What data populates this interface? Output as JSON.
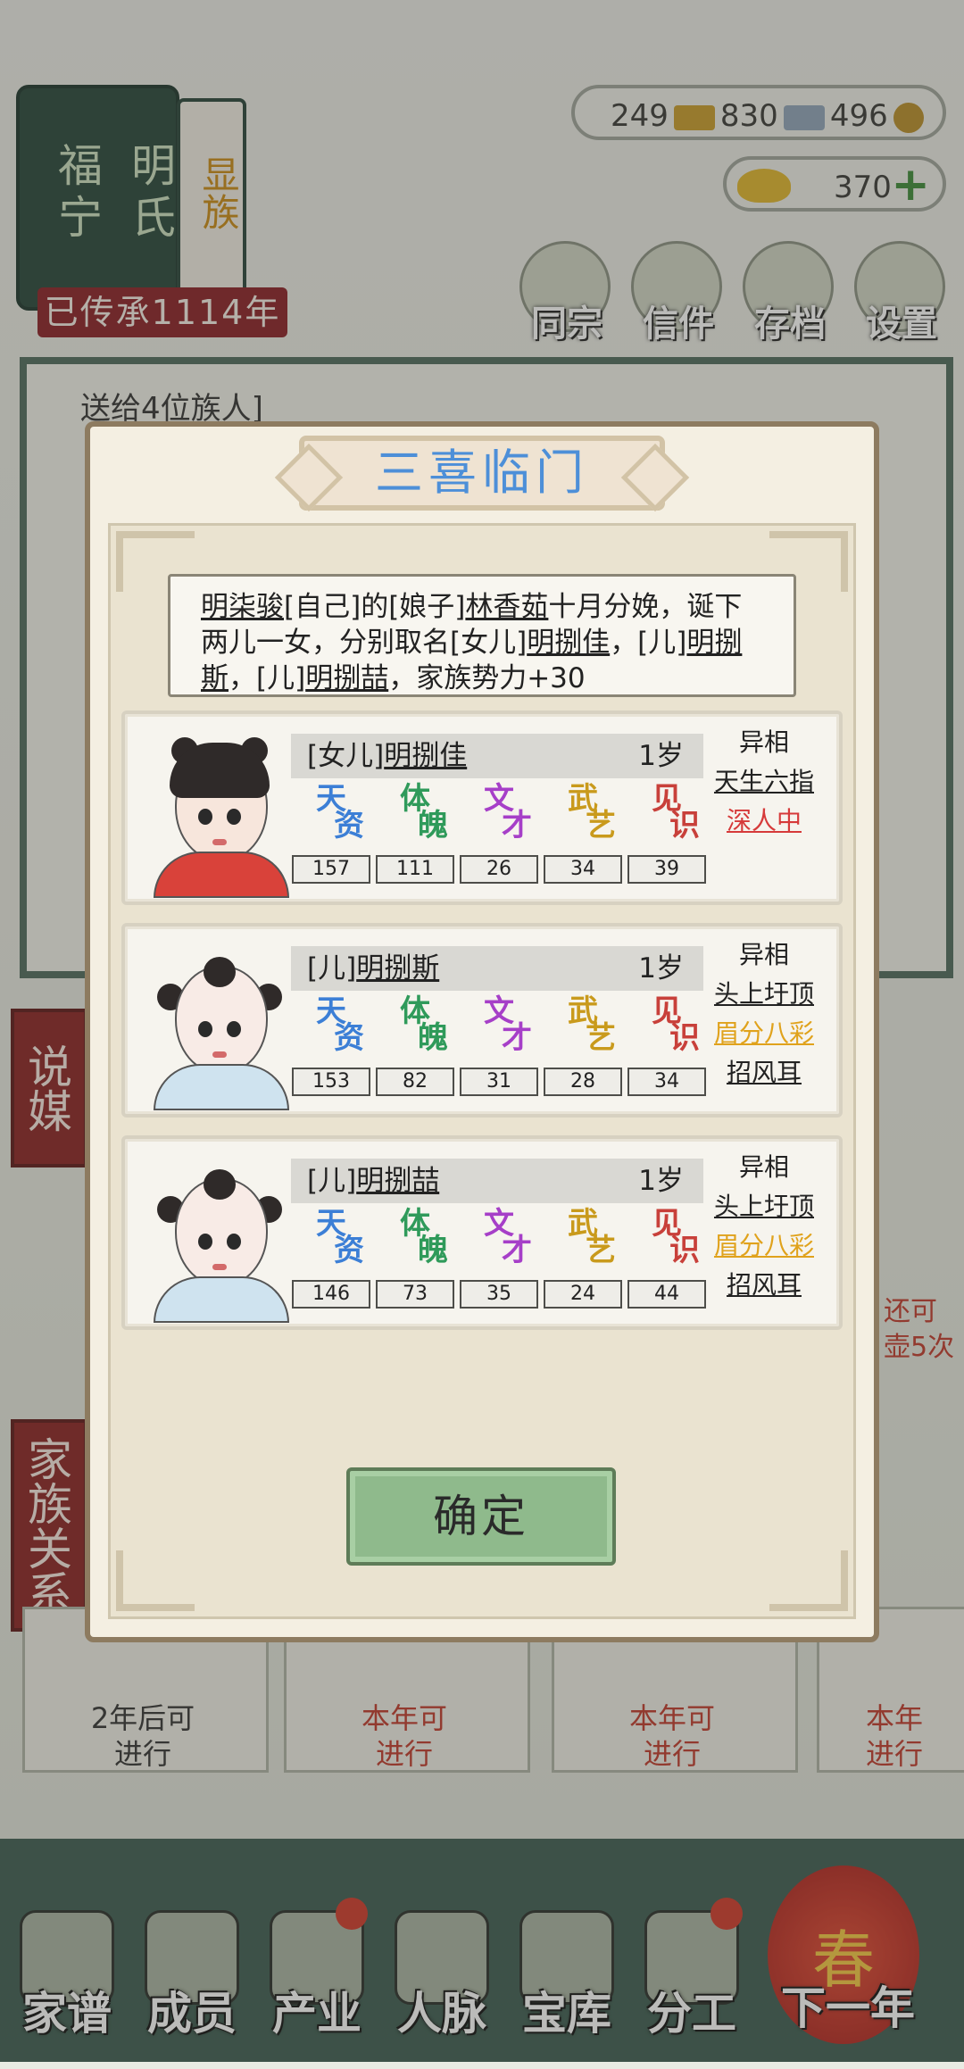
{
  "header": {
    "clan_banner": [
      "福宁",
      "明氏"
    ],
    "clan_tag": "显族",
    "legacy": "已传承1114年",
    "resources": {
      "gold_bars": "249",
      "silver_bars": "830",
      "coins": "496"
    },
    "ingot": "370",
    "menu": [
      {
        "label": "同宗",
        "icon": "books-icon"
      },
      {
        "label": "信件",
        "icon": "letter-icon"
      },
      {
        "label": "存档",
        "icon": "scroll-icon"
      },
      {
        "label": "设置",
        "icon": "gear-icon"
      }
    ]
  },
  "background": {
    "gift_text": "送给4位族人]",
    "side_buttons": [
      "说媒",
      "家族关系"
    ],
    "cards": [
      {
        "text_line1": "2年后可",
        "text_line2": "进行",
        "color": "#333333"
      },
      {
        "text_line1": "本年可",
        "text_line2": "进行",
        "color": "#c0392b"
      },
      {
        "text_line1": "本年可",
        "text_line2": "进行",
        "color": "#c0392b"
      },
      {
        "text_line1": "本年",
        "text_line2": "进行",
        "color": "#c0392b"
      }
    ],
    "right_note": [
      "还可",
      "壶5次"
    ]
  },
  "bottom_nav": [
    {
      "label": "家谱",
      "icon": "genealogy-book-icon"
    },
    {
      "label": "成员",
      "icon": "member-icon"
    },
    {
      "label": "产业",
      "icon": "building-icon"
    },
    {
      "label": "人脉",
      "icon": "network-icon"
    },
    {
      "label": "宝库",
      "icon": "treasure-box-icon"
    },
    {
      "label": "分工",
      "icon": "scroll-task-icon"
    },
    {
      "label": "下一年",
      "icon": "lantern-icon"
    }
  ],
  "lantern_char": "春",
  "modal": {
    "title": "三喜临门",
    "message": {
      "p1": "明柒骏",
      "p2": "[自己]的[娘子]",
      "p3": "林香茹",
      "p4": "十月分娩，诞下两儿一女，分别取名[女儿]",
      "p5": "明捌佳",
      "p6": "，[儿]",
      "p7": "明捌斯",
      "p8": "，[儿]",
      "p9": "明捌喆",
      "p10": "，家族势力+30"
    },
    "stat_labels": [
      {
        "a": "天",
        "b": "资",
        "color": "#3c7fd6"
      },
      {
        "a": "体",
        "b": "魄",
        "color": "#2f9a5a"
      },
      {
        "a": "文",
        "b": "才",
        "color": "#a63fc8"
      },
      {
        "a": "武",
        "b": "艺",
        "color": "#c99a1c"
      },
      {
        "a": "见",
        "b": "识",
        "color": "#c8403a"
      }
    ],
    "children": [
      {
        "relation": "[女儿]",
        "name": "明捌佳",
        "age": "1岁",
        "stats": [
          "157",
          "111",
          "26",
          "34",
          "39"
        ],
        "traits_title": "异相",
        "traits": [
          {
            "text": "天生六指",
            "color": "#222222"
          },
          {
            "text": "深人中",
            "color": "#d63a3a"
          }
        ]
      },
      {
        "relation": "[儿]",
        "name": "明捌斯",
        "age": "1岁",
        "stats": [
          "153",
          "82",
          "31",
          "28",
          "34"
        ],
        "traits_title": "异相",
        "traits": [
          {
            "text": "头上圩顶",
            "color": "#222222"
          },
          {
            "text": "眉分八彩",
            "color": "#e0a21c"
          },
          {
            "text": "招风耳",
            "color": "#222222"
          }
        ]
      },
      {
        "relation": "[儿]",
        "name": "明捌喆",
        "age": "1岁",
        "stats": [
          "146",
          "73",
          "35",
          "24",
          "44"
        ],
        "traits_title": "异相",
        "traits": [
          {
            "text": "头上圩顶",
            "color": "#222222"
          },
          {
            "text": "眉分八彩",
            "color": "#e0a21c"
          },
          {
            "text": "招风耳",
            "color": "#222222"
          }
        ]
      }
    ],
    "confirm_label": "确定"
  }
}
